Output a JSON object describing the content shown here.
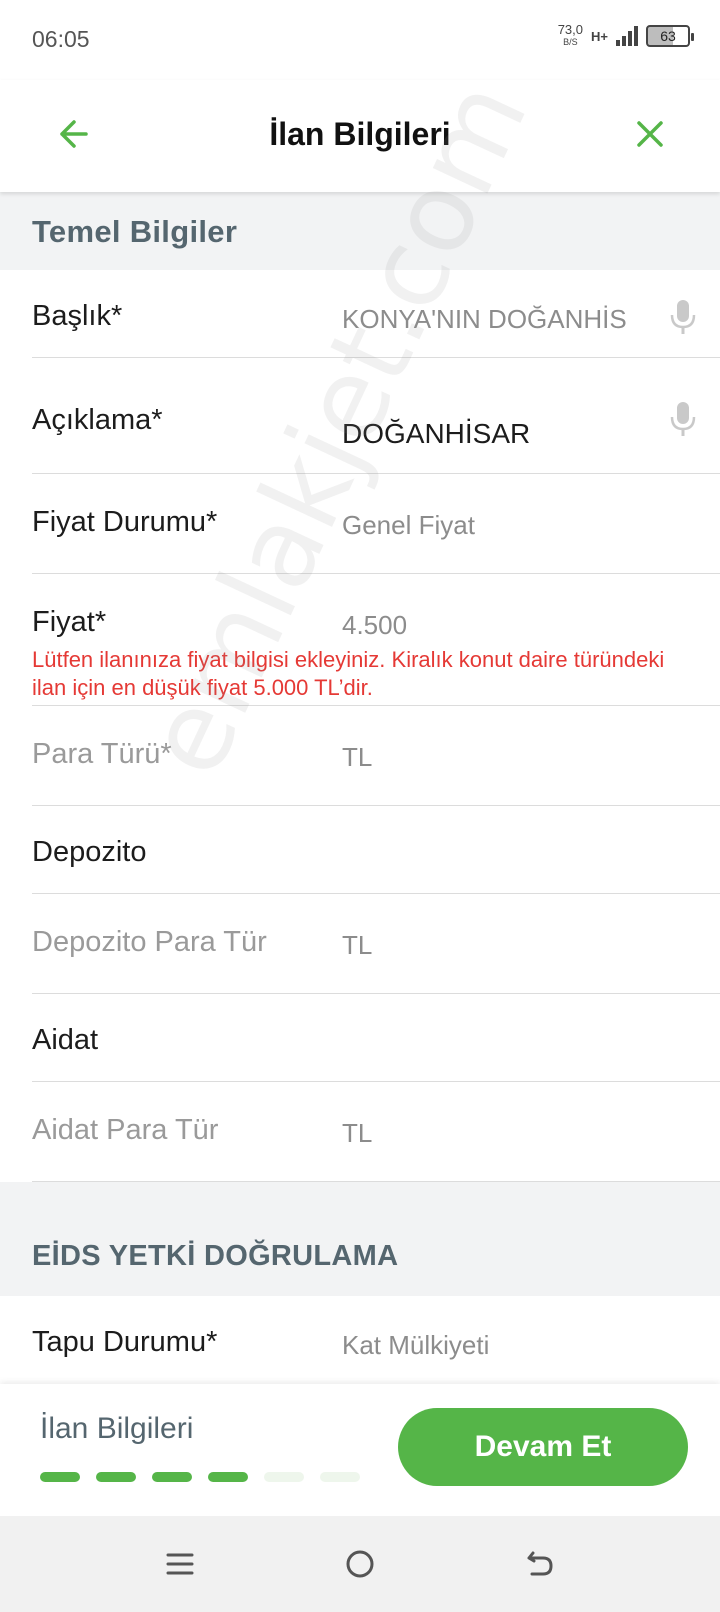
{
  "status": {
    "time": "06:05",
    "net_speed": "73,0",
    "net_speed_unit": "B/S",
    "network_type": "H+",
    "battery": "63"
  },
  "header": {
    "title": "İlan Bilgileri",
    "back_icon": "arrow-left-icon",
    "close_icon": "close-icon",
    "accent_color": "#55b548"
  },
  "sections": {
    "basic": {
      "title": "Temel Bilgiler"
    },
    "eids": {
      "title": "EİDS YETKİ DOĞRULAMA"
    }
  },
  "fields": {
    "title": {
      "label": "Başlık*",
      "value": "KONYA'NIN DOĞANHİS"
    },
    "description": {
      "label": "Açıklama*",
      "value": "DOĞANHİSAR"
    },
    "price_status": {
      "label": "Fiyat Durumu*",
      "value": "Genel Fiyat"
    },
    "price": {
      "label": "Fiyat*",
      "value": "4.500",
      "error": "Lütfen ilanınıza fiyat bilgisi ekleyiniz. Kiralık konut daire türündeki ilan için en düşük fiyat 5.000 TL’dir."
    },
    "currency": {
      "label": "Para Türü*",
      "value": "TL"
    },
    "deposit": {
      "label": "Depozito",
      "value": ""
    },
    "deposit_currency": {
      "label": "Depozito Para Tür",
      "value": "TL"
    },
    "dues": {
      "label": "Aidat",
      "value": ""
    },
    "dues_currency": {
      "label": "Aidat Para Tür",
      "value": "TL"
    },
    "deed_status": {
      "label": "Tapu Durumu*",
      "value": "Kat Mülkiyeti"
    }
  },
  "watermark": "emlakjet.com",
  "footer": {
    "step_label": "İlan Bilgileri",
    "steps_total": 6,
    "steps_completed": 4,
    "continue_label": "Devam Et",
    "active_step_color": "#55b548",
    "inactive_step_color": "#eef6ec"
  },
  "nav": {
    "menu_icon": "menu-icon",
    "home_icon": "home-circle-icon",
    "back_icon": "back-arrow-icon"
  }
}
